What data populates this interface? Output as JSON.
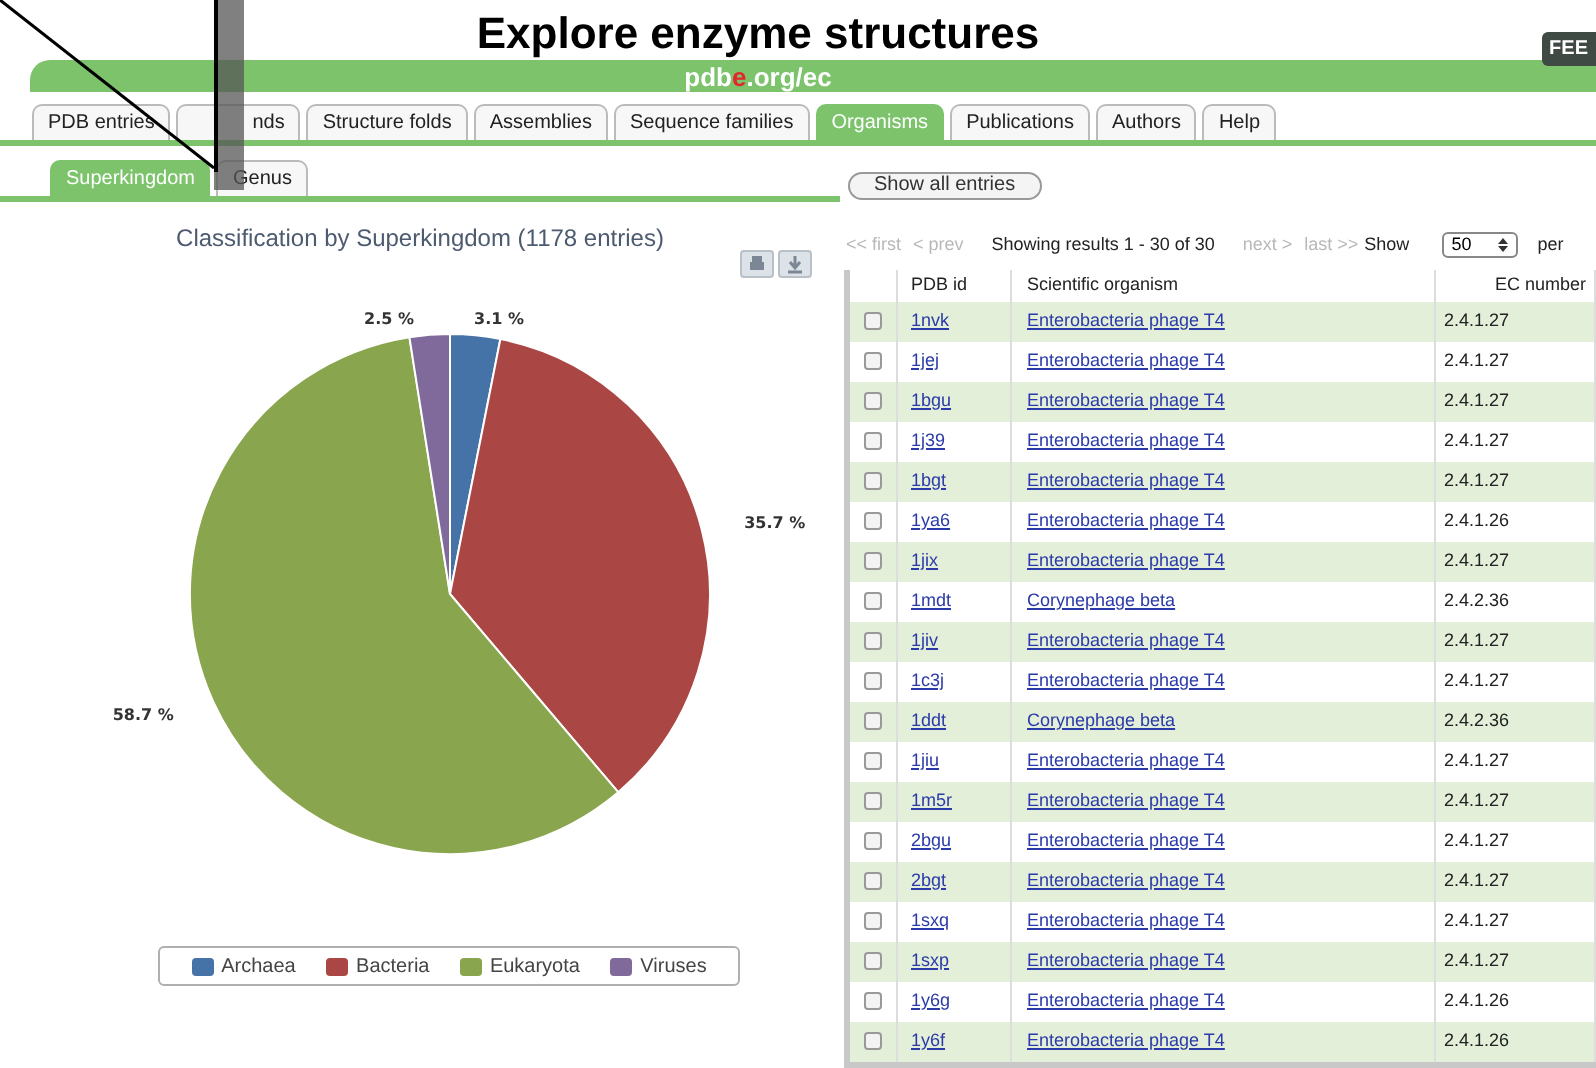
{
  "header": {
    "title": "Explore enzyme structures",
    "site": "pdb**e**.org/ec",
    "badge": "FEE"
  },
  "tabs": [
    {
      "label": "PDB entries",
      "selected": false
    },
    {
      "label": "nds",
      "selected": false
    },
    {
      "label": "Structure folds",
      "selected": false
    },
    {
      "label": "Assemblies",
      "selected": false
    },
    {
      "label": "Sequence families",
      "selected": false
    },
    {
      "label": "Organisms",
      "selected": true
    },
    {
      "label": "Publications",
      "selected": false
    },
    {
      "label": "Authors",
      "selected": false
    },
    {
      "label": "Help",
      "selected": false
    }
  ],
  "subtabs": [
    {
      "label": "Superkingdom",
      "selected": true
    },
    {
      "label": "Genus",
      "selected": false
    }
  ],
  "show_all_button": "Show all entries",
  "chart": {
    "chart_data": {
      "type": "pie",
      "title": "Classification by Superkingdom (1178 entries)",
      "categories": [
        "Archaea",
        "Bacteria",
        "Eukaryota",
        "Viruses"
      ],
      "values": [
        3.1,
        35.7,
        58.7,
        2.5
      ],
      "legend": "bottom",
      "colors": [
        "#4572a7",
        "#aa4643",
        "#89a54e",
        "#80699b"
      ],
      "value_labels": [
        "3.1 %",
        "35.7 %",
        "58.7 %",
        "2.5 %"
      ]
    }
  },
  "pager": {
    "links": [
      {
        "label": "<< first",
        "disabled": true
      },
      {
        "label": "< prev",
        "disabled": true
      }
    ],
    "summary": "Showing results 1 - 30 of 30",
    "next_links": [
      {
        "label": "next >",
        "disabled": true
      },
      {
        "label": "last >>",
        "disabled": true
      }
    ],
    "show_label": "Show",
    "page_size": "50",
    "per": "per"
  },
  "table": {
    "columns": [
      "PDB id",
      "Scientific organism",
      "EC number"
    ],
    "rows": [
      {
        "checked": false,
        "pdb_id": "1nvk",
        "organism": "Enterobacteria phage T4",
        "ec": "2.4.1.27"
      },
      {
        "checked": false,
        "pdb_id": "1jej",
        "organism": "Enterobacteria phage T4",
        "ec": "2.4.1.27"
      },
      {
        "checked": false,
        "pdb_id": "1bgu",
        "organism": "Enterobacteria phage T4",
        "ec": "2.4.1.27"
      },
      {
        "checked": false,
        "pdb_id": "1j39",
        "organism": "Enterobacteria phage T4",
        "ec": "2.4.1.27"
      },
      {
        "checked": false,
        "pdb_id": "1bgt",
        "organism": "Enterobacteria phage T4",
        "ec": "2.4.1.27"
      },
      {
        "checked": false,
        "pdb_id": "1ya6",
        "organism": "Enterobacteria phage T4",
        "ec": "2.4.1.26"
      },
      {
        "checked": false,
        "pdb_id": "1jix",
        "organism": "Enterobacteria phage T4",
        "ec": "2.4.1.27"
      },
      {
        "checked": false,
        "pdb_id": "1mdt",
        "organism": "Corynephage beta",
        "ec": "2.4.2.36"
      },
      {
        "checked": false,
        "pdb_id": "1jiv",
        "organism": "Enterobacteria phage T4",
        "ec": "2.4.1.27"
      },
      {
        "checked": false,
        "pdb_id": "1c3j",
        "organism": "Enterobacteria phage T4",
        "ec": "2.4.1.27"
      },
      {
        "checked": false,
        "pdb_id": "1ddt",
        "organism": "Corynephage beta",
        "ec": "2.4.2.36"
      },
      {
        "checked": false,
        "pdb_id": "1jiu",
        "organism": "Enterobacteria phage T4",
        "ec": "2.4.1.27"
      },
      {
        "checked": false,
        "pdb_id": "1m5r",
        "organism": "Enterobacteria phage T4",
        "ec": "2.4.1.27"
      },
      {
        "checked": false,
        "pdb_id": "2bgu",
        "organism": "Enterobacteria phage T4",
        "ec": "2.4.1.27"
      },
      {
        "checked": false,
        "pdb_id": "2bgt",
        "organism": "Enterobacteria phage T4",
        "ec": "2.4.1.27"
      },
      {
        "checked": false,
        "pdb_id": "1sxq",
        "organism": "Enterobacteria phage T4",
        "ec": "2.4.1.27"
      },
      {
        "checked": false,
        "pdb_id": "1sxp",
        "organism": "Enterobacteria phage T4",
        "ec": "2.4.1.27"
      },
      {
        "checked": false,
        "pdb_id": "1y6g",
        "organism": "Enterobacteria phage T4",
        "ec": "2.4.1.26"
      },
      {
        "checked": false,
        "pdb_id": "1y6f",
        "organism": "Enterobacteria phage T4",
        "ec": "2.4.1.26"
      }
    ]
  }
}
